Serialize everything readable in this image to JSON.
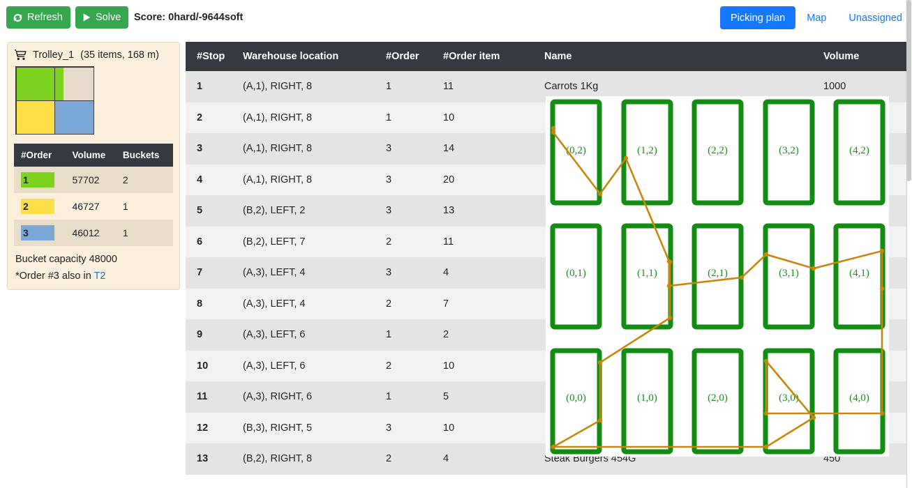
{
  "toolbar": {
    "refresh_label": "Refresh",
    "refresh_icon": "refresh-icon",
    "solve_label": "Solve",
    "solve_icon": "play-icon",
    "score_text": "Score: 0hard/-9644soft",
    "nav": [
      {
        "label": "Picking plan",
        "active": true
      },
      {
        "label": "Map",
        "active": false
      },
      {
        "label": "Unassigned",
        "active": false
      }
    ]
  },
  "sidebar": {
    "trolley_icon": "shopping-cart-icon",
    "trolley_name": "Trolley_1",
    "trolley_meta": "(35 items, 168 m)",
    "bucket_vis": [
      {
        "color": "#7ed321",
        "fill_pct": 100,
        "bg": "#e7dccb"
      },
      {
        "color": "#7ed321",
        "fill_pct": 22,
        "bg": "#e7dccb"
      },
      {
        "color": "#fde047",
        "fill_pct": 100,
        "bg": "#e7dccb"
      },
      {
        "color": "#7ba7d7",
        "fill_pct": 100,
        "bg": "#e7dccb"
      }
    ],
    "order_table": {
      "headers": [
        "#Order",
        "Volume",
        "Buckets"
      ],
      "rows": [
        {
          "order": "1",
          "color": "#7ed321",
          "volume": "57702",
          "buckets": "2"
        },
        {
          "order": "2",
          "color": "#fde047",
          "volume": "46727",
          "buckets": "1"
        },
        {
          "order": "3",
          "color": "#7ba7d7",
          "volume": "46012",
          "buckets": "1"
        }
      ]
    },
    "bucket_capacity": "Bucket capacity 48000",
    "note_prefix": "*Order #3 also in ",
    "note_link": "T2"
  },
  "picking_table": {
    "headers": [
      "#Stop",
      "Warehouse location",
      "#Order",
      "#Order item",
      "Name",
      "Volume"
    ],
    "rows": [
      {
        "stop": "1",
        "location": "(A,1), RIGHT, 8",
        "order": "1",
        "order_item": "11",
        "name": "Carrots 1Kg",
        "volume": "1000"
      },
      {
        "stop": "2",
        "location": "(A,1), RIGHT, 8",
        "order": "1",
        "order_item": "10",
        "name": "",
        "volume": ""
      },
      {
        "stop": "3",
        "location": "(A,1), RIGHT, 8",
        "order": "3",
        "order_item": "14",
        "name": "",
        "volume": ""
      },
      {
        "stop": "4",
        "location": "(A,1), RIGHT, 8",
        "order": "3",
        "order_item": "20",
        "name": "",
        "volume": ""
      },
      {
        "stop": "5",
        "location": "(B,2), LEFT, 2",
        "order": "3",
        "order_item": "13",
        "name": "",
        "volume": ""
      },
      {
        "stop": "6",
        "location": "(B,2), LEFT, 7",
        "order": "2",
        "order_item": "11",
        "name": "",
        "volume": ""
      },
      {
        "stop": "7",
        "location": "(A,3), LEFT, 4",
        "order": "3",
        "order_item": "4",
        "name": "",
        "volume": ""
      },
      {
        "stop": "8",
        "location": "(A,3), LEFT, 4",
        "order": "2",
        "order_item": "7",
        "name": "",
        "volume": ""
      },
      {
        "stop": "9",
        "location": "(A,3), LEFT, 6",
        "order": "1",
        "order_item": "2",
        "name": "",
        "volume": ""
      },
      {
        "stop": "10",
        "location": "(A,3), LEFT, 6",
        "order": "2",
        "order_item": "10",
        "name": "",
        "volume": ""
      },
      {
        "stop": "11",
        "location": "(A,3), RIGHT, 6",
        "order": "1",
        "order_item": "5",
        "name": "",
        "volume": ""
      },
      {
        "stop": "12",
        "location": "(B,3), RIGHT, 5",
        "order": "3",
        "order_item": "10",
        "name": "",
        "volume": ""
      },
      {
        "stop": "13",
        "location": "(B,2), RIGHT, 8",
        "order": "2",
        "order_item": "4",
        "name": "Steak Burgers 454G",
        "volume": "450"
      }
    ]
  },
  "map_overlay": {
    "shelf_labels": [
      "(0,2)",
      "(1,2)",
      "(2,2)",
      "(3,2)",
      "(4,2)",
      "(0,1)",
      "(1,1)",
      "(2,1)",
      "(3,1)",
      "(4,1)",
      "(0,0)",
      "(1,0)",
      "(2,0)",
      "(3,0)",
      "(4,0)"
    ],
    "shelf_color": "#128c12",
    "route_color": "#c8860d"
  },
  "scrollbar": {
    "visible": true
  }
}
